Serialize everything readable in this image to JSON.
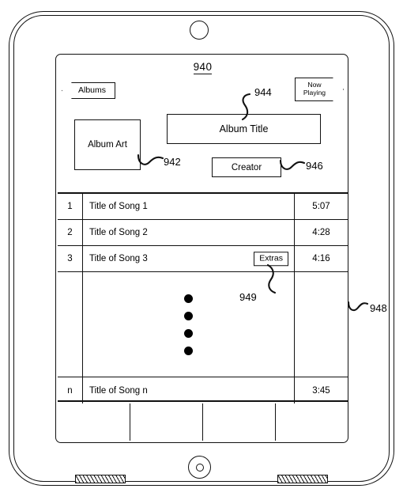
{
  "figure": {
    "number": "940"
  },
  "device": {
    "camera_label": "front-camera",
    "home_label": "home-button"
  },
  "screen": {
    "nav": {
      "back_label": "Albums",
      "now_playing_line1": "Now",
      "now_playing_line2": "Playing"
    },
    "album": {
      "art_label": "Album Art",
      "title_label": "Album Title",
      "creator_label": "Creator"
    },
    "tracklist": {
      "rows": [
        {
          "num": "1",
          "title": "Title of Song 1",
          "duration": "5:07",
          "extras": ""
        },
        {
          "num": "2",
          "title": "Title of Song 2",
          "duration": "4:28",
          "extras": ""
        },
        {
          "num": "3",
          "title": "Title of Song 3",
          "duration": "4:16",
          "extras": "Extras"
        }
      ],
      "ellipsis_dots": 4,
      "last_row": {
        "num": "n",
        "title": "Title of Song n",
        "duration": "3:45"
      }
    },
    "tabbar": {
      "tabs": [
        "",
        "",
        "",
        ""
      ]
    }
  },
  "callouts": [
    {
      "id": "940",
      "label": "940",
      "target": "figure-number"
    },
    {
      "id": "942",
      "label": "942",
      "target": "album-art"
    },
    {
      "id": "944",
      "label": "944",
      "target": "album-title"
    },
    {
      "id": "946",
      "label": "946",
      "target": "creator"
    },
    {
      "id": "948",
      "label": "948",
      "target": "tracklist"
    },
    {
      "id": "949",
      "label": "949",
      "target": "extras-badge"
    }
  ],
  "colors": {
    "ink": "#111111",
    "paper": "#ffffff"
  }
}
